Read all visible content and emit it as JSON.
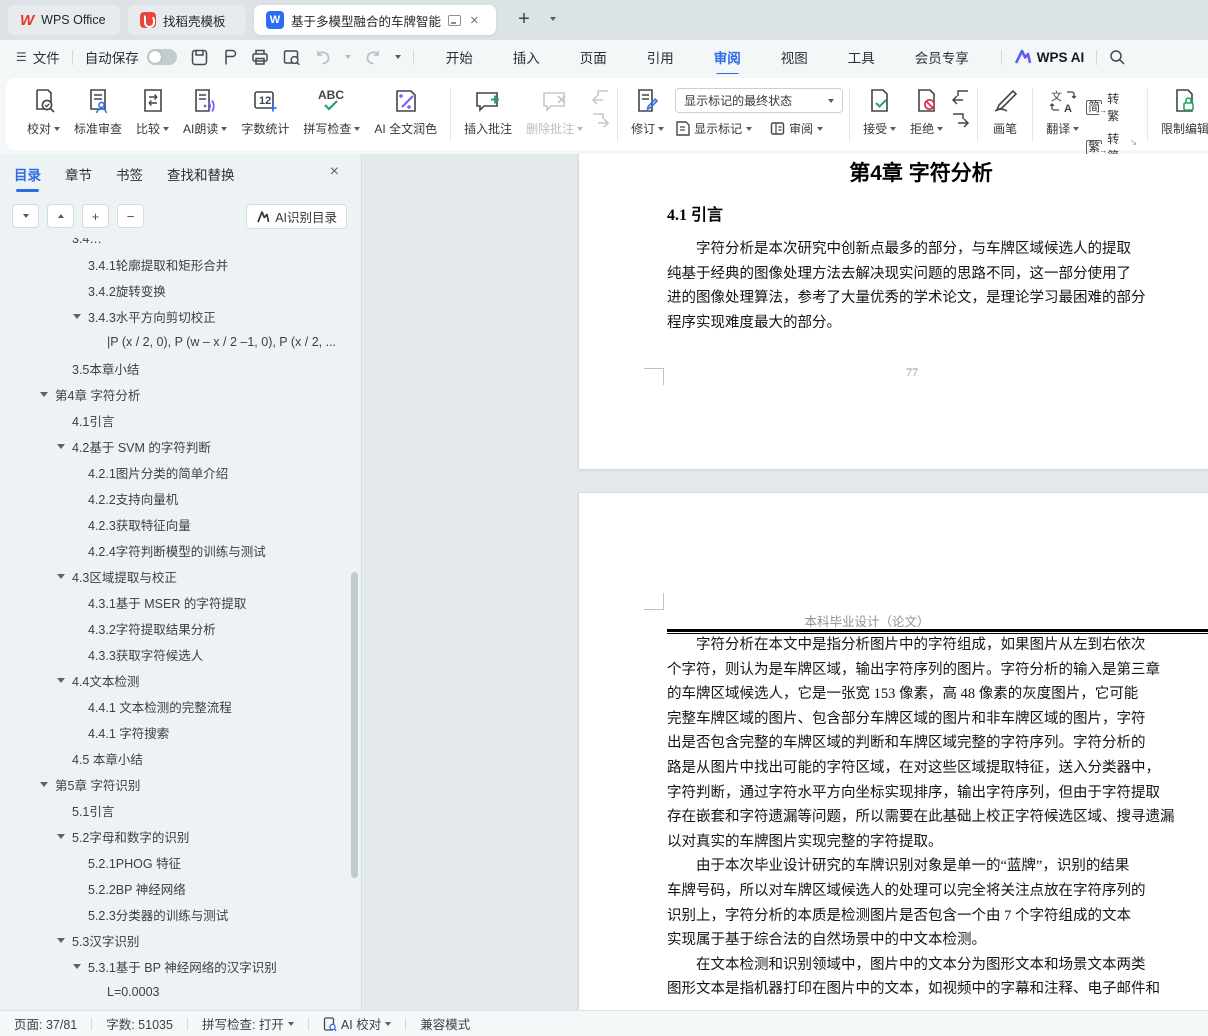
{
  "window": {
    "tabs": [
      {
        "label": "WPS Office"
      },
      {
        "label": "找稻壳模板"
      },
      {
        "label": "基于多模型融合的车牌智能识",
        "active": true
      }
    ]
  },
  "menu_bar": {
    "file_label": "文件",
    "autosave_label": "自动保存",
    "menus": [
      {
        "label": "开始"
      },
      {
        "label": "插入"
      },
      {
        "label": "页面"
      },
      {
        "label": "引用"
      },
      {
        "label": "审阅",
        "active": true
      },
      {
        "label": "视图"
      },
      {
        "label": "工具"
      },
      {
        "label": "会员专享"
      }
    ],
    "wps_ai_label": "WPS AI"
  },
  "ribbon": {
    "proofread": "校对",
    "standard_review": "标准审查",
    "compare": "比较",
    "ai_read": "AI朗读",
    "word_count": "字数统计",
    "spell_check": "拼写检查",
    "ai_polish": "AI 全文润色",
    "insert_comment": "插入批注",
    "delete_comment": "删除批注",
    "track_changes": "修订",
    "markup_state": "显示标记的最终状态",
    "show_markup": "显示标记",
    "review_pane": "审阅",
    "accept": "接受",
    "reject": "拒绝",
    "brush": "画笔",
    "translate": "翻译",
    "simp_glyph": "简",
    "trad_glyph": "繁",
    "to_trad": "转繁",
    "to_simp": "转简",
    "restrict_edit": "限制编辑",
    "count_badge": "12",
    "abc": "ABC"
  },
  "sidebar": {
    "tabs": [
      {
        "label": "目录",
        "active": true
      },
      {
        "label": "章节"
      },
      {
        "label": "书签"
      },
      {
        "label": "查找和替换"
      }
    ],
    "ai_toc_button": "AI识别目录",
    "toc": [
      {
        "label": "3.4…",
        "level": 1,
        "clipped": true
      },
      {
        "label": "3.4.1轮廓提取和矩形合并",
        "level": 2
      },
      {
        "label": "3.4.2旋转变换",
        "level": 2
      },
      {
        "label": "3.4.3水平方向剪切校正",
        "level": 2,
        "arrow": true
      },
      {
        "label": "|P (x / 2, 0), P (w – x / 2 –1, 0), P (x / 2, ...",
        "level": 3
      },
      {
        "label": "3.5本章小结",
        "level": 1
      },
      {
        "label": "第4章 字符分析",
        "level": 0,
        "arrow": true
      },
      {
        "label": "4.1引言",
        "level": 1
      },
      {
        "label": "4.2基于 SVM 的字符判断",
        "level": 1,
        "arrow": true
      },
      {
        "label": "4.2.1图片分类的简单介绍",
        "level": 2
      },
      {
        "label": "4.2.2支持向量机",
        "level": 2
      },
      {
        "label": "4.2.3获取特征向量",
        "level": 2
      },
      {
        "label": "4.2.4字符判断模型的训练与测试",
        "level": 2
      },
      {
        "label": "4.3区域提取与校正",
        "level": 1,
        "arrow": true
      },
      {
        "label": "4.3.1基于 MSER 的字符提取",
        "level": 2
      },
      {
        "label": "4.3.2字符提取结果分析",
        "level": 2
      },
      {
        "label": "4.3.3获取字符候选人",
        "level": 2
      },
      {
        "label": "4.4文本检测",
        "level": 1,
        "arrow": true
      },
      {
        "label": "4.4.1 文本检测的完整流程",
        "level": 2
      },
      {
        "label": "4.4.1 字符搜索",
        "level": 2
      },
      {
        "label": "4.5 本章小结",
        "level": 1
      },
      {
        "label": "第5章 字符识别",
        "level": 0,
        "arrow": true
      },
      {
        "label": "5.1引言",
        "level": 1
      },
      {
        "label": "5.2字母和数字的识别",
        "level": 1,
        "arrow": true
      },
      {
        "label": "5.2.1PHOG 特征",
        "level": 2
      },
      {
        "label": "5.2.2BP 神经网络",
        "level": 2
      },
      {
        "label": "5.2.3分类器的训练与测试",
        "level": 2
      },
      {
        "label": "5.3汉字识别",
        "level": 1,
        "arrow": true
      },
      {
        "label": "5.3.1基于 BP 神经网络的汉字识别",
        "level": 2,
        "arrow": true
      },
      {
        "label": "L=0.0003",
        "level": 3
      }
    ]
  },
  "document": {
    "page1": {
      "chapter_title": "第4章 字符分析",
      "section_title": "4.1 引言",
      "lines": [
        {
          "text": "字符分析是本次研究中创新点最多的部分，与车牌区域候选人的提取",
          "indent": true
        },
        {
          "text": "纯基于经典的图像处理方法去解决现实问题的思路不同，这一部分使用了"
        },
        {
          "text": "进的图像处理算法，参考了大量优秀的学术论文，是理论学习最困难的部分"
        },
        {
          "text": "程序实现难度最大的部分。"
        }
      ],
      "page_number": "77"
    },
    "page2": {
      "header": "本科毕业设计（论文）",
      "lines": [
        {
          "text": "字符分析在本文中是指分析图片中的字符组成，如果图片从左到右依次",
          "indent": true
        },
        {
          "text": "个字符，则认为是车牌区域，输出字符序列的图片。字符分析的输入是第三章"
        },
        {
          "text": "的车牌区域候选人，它是一张宽 153 像素，高 48 像素的灰度图片，它可能"
        },
        {
          "text": "完整车牌区域的图片、包含部分车牌区域的图片和非车牌区域的图片，字符"
        },
        {
          "text": "出是否包含完整的车牌区域的判断和车牌区域完整的字符序列。字符分析的"
        },
        {
          "text": "路是从图片中找出可能的字符区域，在对这些区域提取特征，送入分类器中，"
        },
        {
          "text": "字符判断，通过字符水平方向坐标实现排序，输出字符序列，但由于字符提取"
        },
        {
          "text": "存在嵌套和字符遗漏等问题，所以需要在此基础上校正字符候选区域、搜寻遗漏"
        },
        {
          "text": "以对真实的车牌图片实现完整的字符提取。"
        },
        {
          "text": "由于本次毕业设计研究的车牌识别对象是单一的“蓝牌”，识别的结果",
          "indent": true
        },
        {
          "text": "车牌号码，所以对车牌区域候选人的处理可以完全将关注点放在字符序列的"
        },
        {
          "text": "识别上，字符分析的本质是检测图片是否包含一个由 7 个字符组成的文本"
        },
        {
          "text": "实现属于基于综合法的自然场景中的中文本检测。"
        },
        {
          "text": "在文本检测和识别领域中，图片中的文本分为图形文本和场景文本两类",
          "indent": true
        },
        {
          "text": "图形文本是指机器打印在图片中的文本，如视频中的字幕和注释、电子邮件和"
        }
      ]
    }
  },
  "status_bar": {
    "page": "页面: 37/81",
    "words": "字数: 51035",
    "spell": "拼写检查: 打开",
    "ai_proof": "AI 校对",
    "mode": "兼容模式"
  },
  "icons": {
    "plus": "+",
    "minus": "−",
    "close": "×",
    "hamburger": "☰",
    "expand_corner": "↘"
  },
  "colors": {
    "accent_blue": "#2e6be6",
    "green": "#21a666",
    "red": "#e03e3e",
    "purple": "#7a5af5"
  }
}
